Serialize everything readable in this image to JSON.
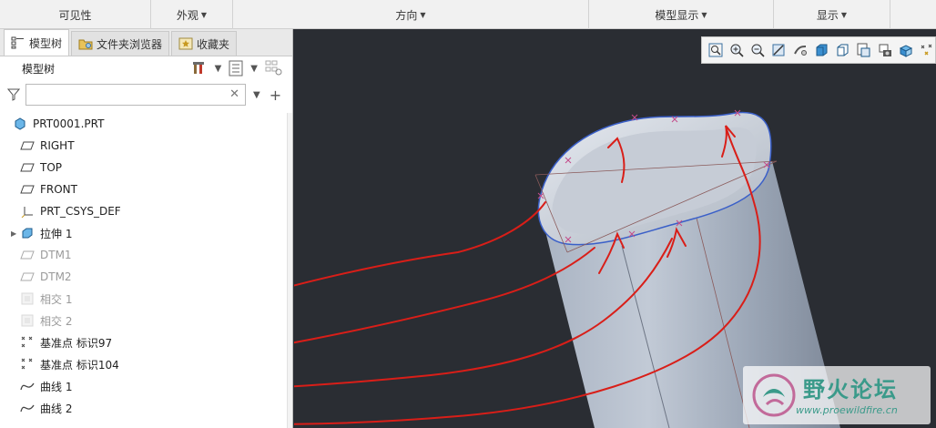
{
  "ribbon": {
    "groups": [
      {
        "label": "可见性",
        "dropdown": false
      },
      {
        "label": "外观",
        "dropdown": true
      },
      {
        "label": "方向",
        "dropdown": true
      },
      {
        "label": "模型显示",
        "dropdown": true
      },
      {
        "label": "显示",
        "dropdown": true
      }
    ]
  },
  "tabs": [
    {
      "label": "模型树",
      "icon": "model-tree-icon"
    },
    {
      "label": "文件夹浏览器",
      "icon": "folder-browser-icon"
    },
    {
      "label": "收藏夹",
      "icon": "favorites-icon"
    }
  ],
  "tree_header": {
    "title": "模型树"
  },
  "filter": {
    "value": "",
    "placeholder": ""
  },
  "tree": [
    {
      "label": "PRT0001.PRT",
      "icon": "part-icon",
      "dim": false,
      "expandable": false
    },
    {
      "label": "RIGHT",
      "icon": "datum-plane-icon",
      "dim": false,
      "expandable": false
    },
    {
      "label": "TOP",
      "icon": "datum-plane-icon",
      "dim": false,
      "expandable": false
    },
    {
      "label": "FRONT",
      "icon": "datum-plane-icon",
      "dim": false,
      "expandable": false
    },
    {
      "label": "PRT_CSYS_DEF",
      "icon": "csys-icon",
      "dim": false,
      "expandable": false
    },
    {
      "label": "拉伸 1",
      "icon": "extrude-icon",
      "dim": false,
      "expandable": true
    },
    {
      "label": "DTM1",
      "icon": "datum-plane-icon",
      "dim": true,
      "expandable": false
    },
    {
      "label": "DTM2",
      "icon": "datum-plane-icon",
      "dim": true,
      "expandable": false
    },
    {
      "label": "相交 1",
      "icon": "intersect-icon",
      "dim": true,
      "expandable": false
    },
    {
      "label": "相交 2",
      "icon": "intersect-icon",
      "dim": true,
      "expandable": false
    },
    {
      "label": "基准点 标识97",
      "icon": "datum-point-icon",
      "dim": false,
      "expandable": false
    },
    {
      "label": "基准点 标识104",
      "icon": "datum-point-icon",
      "dim": false,
      "expandable": false
    },
    {
      "label": "曲线 1",
      "icon": "curve-icon",
      "dim": false,
      "expandable": false
    },
    {
      "label": "曲线 2",
      "icon": "curve-icon",
      "dim": false,
      "expandable": false
    }
  ],
  "view_toolbar": [
    "zoom-fit-icon",
    "zoom-in-icon",
    "zoom-out-icon",
    "repaint-icon",
    "spin-center-icon",
    "display-style-icon",
    "saved-views-icon",
    "view-manager-icon",
    "perspective-icon",
    "datum-display-icon"
  ],
  "watermark": {
    "title": "野火论坛",
    "url": "www.proewildfire.cn"
  }
}
